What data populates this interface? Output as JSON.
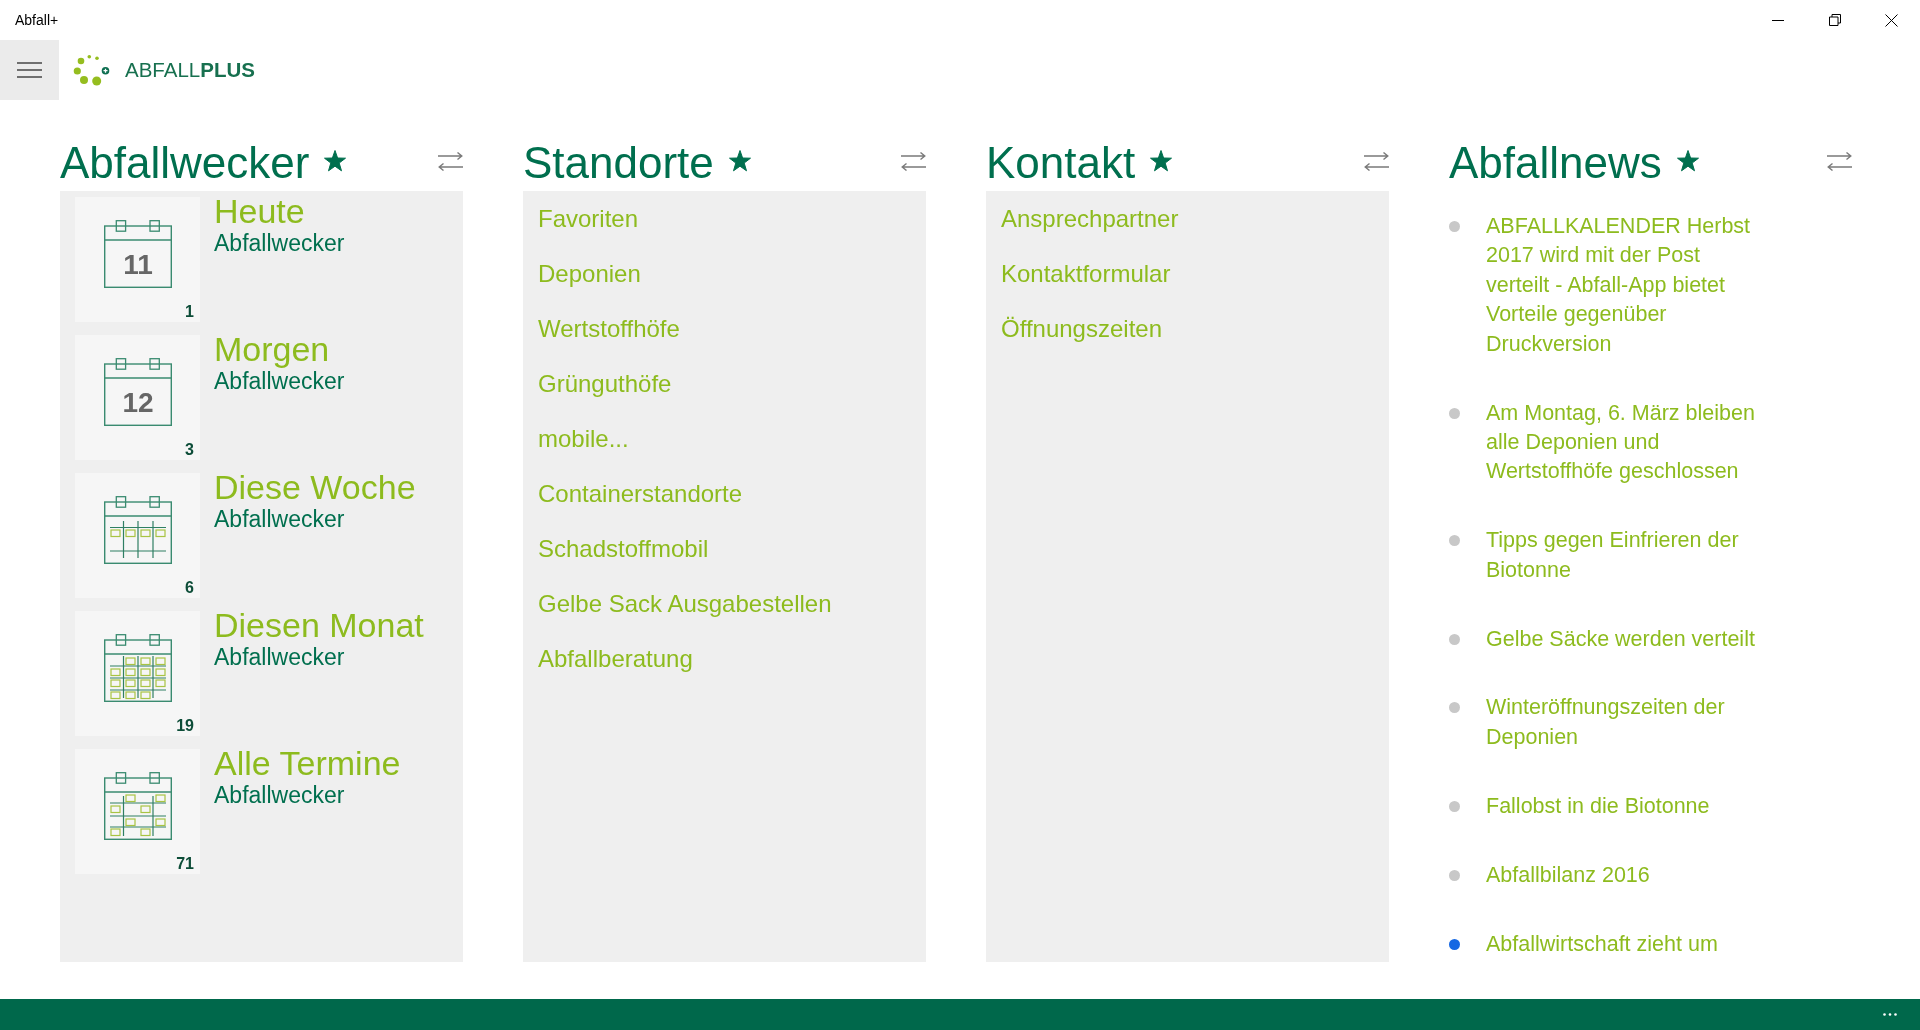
{
  "window": {
    "title": "Abfall+"
  },
  "header": {
    "logo_text": "ABFALL**PLUS**"
  },
  "sections": [
    {
      "kind": "alarms",
      "title": "Abfallwecker",
      "starred": true,
      "items": [
        {
          "kind": "day",
          "date": "11",
          "title": "Heute",
          "subtitle": "Abfallwecker",
          "count": "1"
        },
        {
          "kind": "day",
          "date": "12",
          "title": "Morgen",
          "subtitle": "Abfallwecker",
          "count": "3"
        },
        {
          "kind": "week",
          "title": "Diese Woche",
          "subtitle": "Abfallwecker",
          "count": "6"
        },
        {
          "kind": "month",
          "title": "Diesen Monat",
          "subtitle": "Abfallwecker",
          "count": "19"
        },
        {
          "kind": "all",
          "title": "Alle Termine",
          "subtitle": "Abfallwecker",
          "count": "71"
        }
      ]
    },
    {
      "kind": "links",
      "title": "Standorte",
      "starred": true,
      "items": [
        {
          "label": "Favoriten"
        },
        {
          "label": "Deponien"
        },
        {
          "label": "Wertstoffhöfe"
        },
        {
          "label": "Grünguthöfe"
        },
        {
          "label": "mobile..."
        },
        {
          "label": "Containerstandorte"
        },
        {
          "label": "Schadstoffmobil"
        },
        {
          "label": "Gelbe Sack Ausgabestellen"
        },
        {
          "label": "Abfallberatung"
        }
      ]
    },
    {
      "kind": "links",
      "title": "Kontakt",
      "starred": true,
      "items": [
        {
          "label": "Ansprechpartner"
        },
        {
          "label": "Kontaktformular"
        },
        {
          "label": "Öffnungszeiten"
        }
      ]
    },
    {
      "kind": "news",
      "title": "Abfallnews",
      "starred": true,
      "items": [
        {
          "text": "ABFALLKALENDER Herbst 2017 wird mit der Post verteilt - Abfall-App bietet Vorteile gegenüber Druckversion",
          "color": "#c8c8c8"
        },
        {
          "text": "Am Montag, 6. März bleiben alle Deponien und Wertstoffhöfe geschlossen",
          "color": "#c8c8c8"
        },
        {
          "text": "Tipps gegen Einfrieren der Biotonne",
          "color": "#c8c8c8"
        },
        {
          "text": "Gelbe Säcke werden verteilt",
          "color": "#c8c8c8"
        },
        {
          "text": "Winteröffnungszeiten der Deponien",
          "color": "#c8c8c8"
        },
        {
          "text": "Fallobst in die Biotonne",
          "color": "#c8c8c8"
        },
        {
          "text": "Abfallbilanz 2016",
          "color": "#c8c8c8"
        },
        {
          "text": "Abfallwirtschaft zieht um",
          "color": "#1668e3"
        }
      ]
    }
  ]
}
